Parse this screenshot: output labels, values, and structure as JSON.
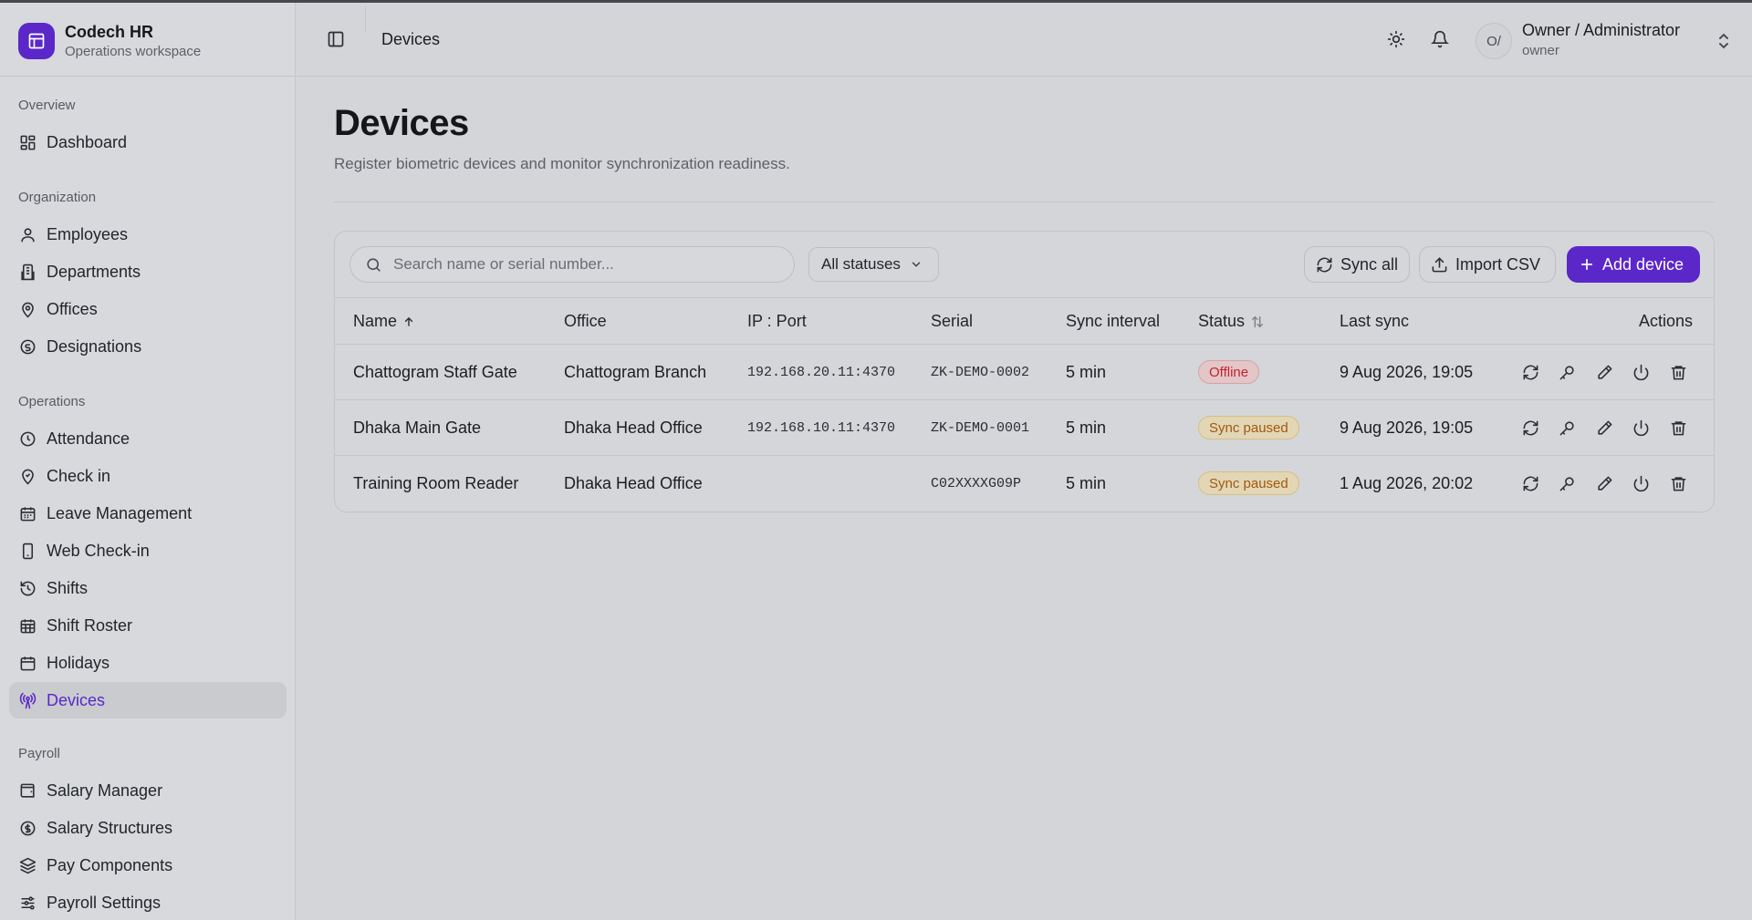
{
  "brand": {
    "name": "Codech HR",
    "subtitle": "Operations workspace"
  },
  "sidebar": {
    "sections": [
      {
        "title": "Overview",
        "items": [
          {
            "label": "Dashboard",
            "icon": "dashboard-icon"
          }
        ]
      },
      {
        "title": "Organization",
        "items": [
          {
            "label": "Employees",
            "icon": "users-icon"
          },
          {
            "label": "Departments",
            "icon": "building-icon"
          },
          {
            "label": "Offices",
            "icon": "map-pin-icon"
          },
          {
            "label": "Designations",
            "icon": "badge-icon"
          }
        ]
      },
      {
        "title": "Operations",
        "items": [
          {
            "label": "Attendance",
            "icon": "clock-icon"
          },
          {
            "label": "Check in",
            "icon": "location-check-icon"
          },
          {
            "label": "Leave Management",
            "icon": "calendar-icon"
          },
          {
            "label": "Web Check-in",
            "icon": "smartphone-icon"
          },
          {
            "label": "Shifts",
            "icon": "history-icon"
          },
          {
            "label": "Shift Roster",
            "icon": "calendar-grid-icon"
          },
          {
            "label": "Holidays",
            "icon": "calendar-days-icon"
          },
          {
            "label": "Devices",
            "icon": "radio-tower-icon",
            "active": true
          }
        ]
      },
      {
        "title": "Payroll",
        "items": [
          {
            "label": "Salary Manager",
            "icon": "wallet-icon"
          },
          {
            "label": "Salary Structures",
            "icon": "dollar-circle-icon"
          },
          {
            "label": "Pay Components",
            "icon": "layers-icon"
          },
          {
            "label": "Payroll Settings",
            "icon": "sliders-icon"
          }
        ]
      }
    ]
  },
  "header": {
    "title": "Devices",
    "user": {
      "initials": "O/",
      "name": "Owner / Administrator",
      "role": "owner"
    }
  },
  "page": {
    "title": "Devices",
    "subtitle": "Register biometric devices and monitor synchronization readiness."
  },
  "toolbar": {
    "search_placeholder": "Search name or serial number...",
    "search_value": "",
    "status_filter": "All statuses",
    "sync_all": "Sync all",
    "import_csv": "Import CSV",
    "add_device": "Add device"
  },
  "table": {
    "columns": {
      "name": "Name",
      "office": "Office",
      "ip_port": "IP : Port",
      "serial": "Serial",
      "sync_interval": "Sync interval",
      "status": "Status",
      "last_sync": "Last sync",
      "actions": "Actions"
    },
    "rows": [
      {
        "name": "Chattogram Staff Gate",
        "office": "Chattogram Branch",
        "ip_port": "192.168.20.11:4370",
        "serial": "ZK-DEMO-0002",
        "sync_interval": "5 min",
        "status": "Offline",
        "status_kind": "offline",
        "last_sync": "9 Aug 2026, 19:05"
      },
      {
        "name": "Dhaka Main Gate",
        "office": "Dhaka Head Office",
        "ip_port": "192.168.10.11:4370",
        "serial": "ZK-DEMO-0001",
        "sync_interval": "5 min",
        "status": "Sync paused",
        "status_kind": "paused",
        "last_sync": "9 Aug 2026, 19:05"
      },
      {
        "name": "Training Room Reader",
        "office": "Dhaka Head Office",
        "ip_port": "",
        "serial": "C02XXXXG09P",
        "sync_interval": "5 min",
        "status": "Sync paused",
        "status_kind": "paused",
        "last_sync": "1 Aug 2026, 20:02"
      }
    ]
  },
  "colors": {
    "accent": "#5b27c9",
    "offline": "#c4222f",
    "paused": "#a2580f"
  }
}
